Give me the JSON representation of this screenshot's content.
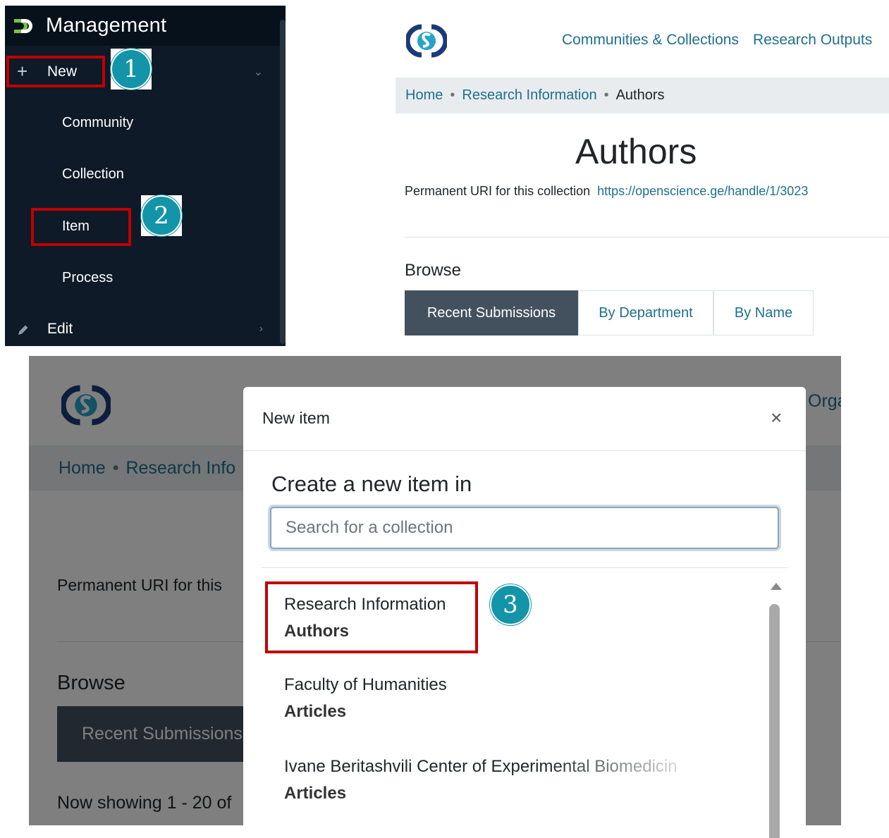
{
  "sidebar": {
    "title": "Management",
    "items": [
      {
        "label": "New"
      },
      {
        "label": "Community"
      },
      {
        "label": "Collection"
      },
      {
        "label": "Item"
      },
      {
        "label": "Process"
      },
      {
        "label": "Edit"
      }
    ]
  },
  "callouts": [
    "1",
    "2",
    "3"
  ],
  "collection_page": {
    "nav": [
      "Communities & Collections",
      "Research Outputs"
    ],
    "breadcrumb": [
      "Home",
      "Research Information",
      "Authors"
    ],
    "title": "Authors",
    "uri_label": "Permanent URI for this collection",
    "uri_value": "https://openscience.ge/handle/1/3023",
    "browse_heading": "Browse",
    "browse_tabs": [
      "Recent Submissions",
      "By Department",
      "By Name"
    ]
  },
  "background_page": {
    "nav_partial": "Orga",
    "breadcrumb": [
      "Home",
      "Research Info"
    ],
    "uri_partial": "Permanent URI for this",
    "browse_heading": "Browse",
    "recent_tab": "Recent Submissions",
    "showing_partial": "Now showing 1 - 20 of"
  },
  "modal": {
    "title": "New item",
    "close_glyph": "×",
    "subtitle": "Create a new item in",
    "search_placeholder": "Search for a collection",
    "collections": [
      {
        "parent": "Research Information",
        "name": "Authors"
      },
      {
        "parent": "Faculty of Humanities",
        "name": "Articles"
      },
      {
        "parent": "Ivane Beritashvili Center of Experimental Biomedicin",
        "name": "Articles"
      }
    ]
  },
  "colors": {
    "sidebar_bg": "#0e1a27",
    "link": "#1f6f8e",
    "highlight": "#c00000",
    "callout": "#1394a9",
    "active_tab": "#43515f"
  }
}
